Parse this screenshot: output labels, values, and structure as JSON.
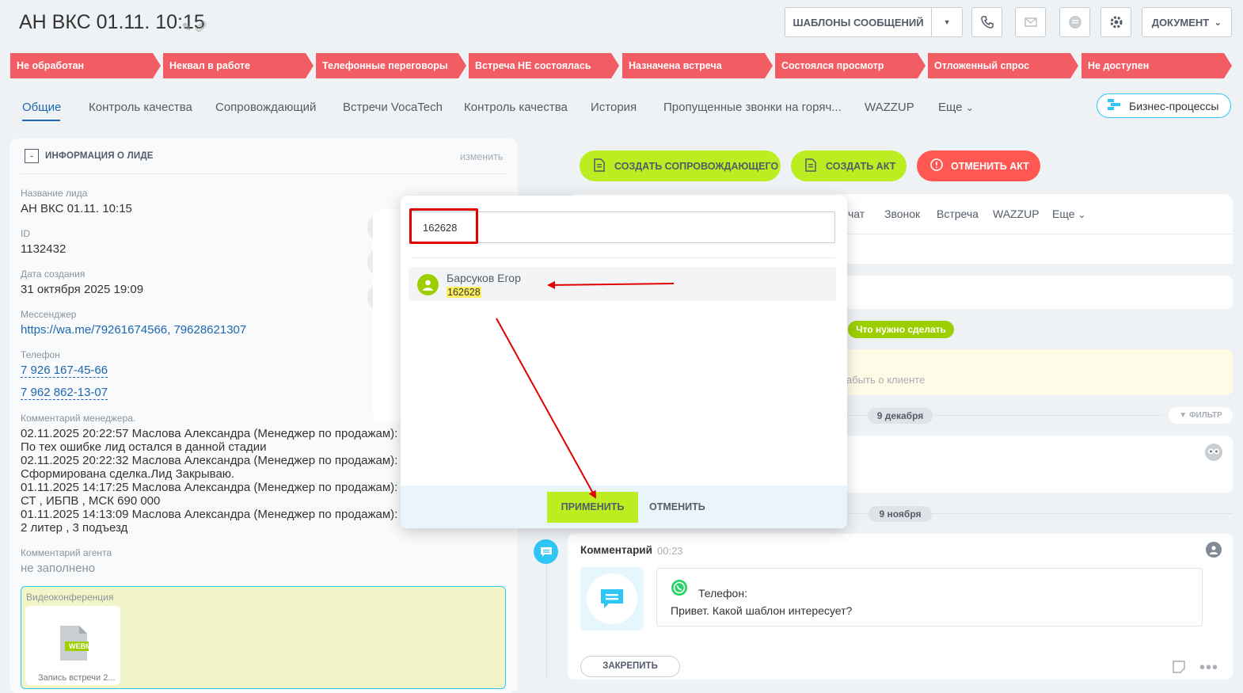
{
  "header": {
    "title": "АН ВКС 01.11. 10:15",
    "templates_button": "ШАБЛОНЫ СООБЩЕНИЙ",
    "document_button": "ДОКУМЕНТ"
  },
  "stages": [
    "Не обработан",
    "Неквал в работе",
    "Телефонные переговоры",
    "Встреча НЕ состоялась",
    "Назначена встреча",
    "Состоялся просмотр",
    "Отложенный спрос",
    "Не доступен"
  ],
  "colors": {
    "stage": "#f25c63",
    "accent_blue": "#2067b0",
    "green_button": "#bbed21",
    "red_button": "#ff5752",
    "highlight": "#ffef5a",
    "annotation_red": "#e10000"
  },
  "tabs": [
    "Общие",
    "Контроль качества",
    "Сопровождающий",
    "Встречи VocaTech",
    "Контроль качества",
    "История",
    "Пропущенные звонки на горяч...",
    "WAZZUP",
    "Еще"
  ],
  "business_processes": "Бизнес-процессы",
  "lead_info": {
    "collapse_symbol": "-",
    "section_title": "ИНФОРМАЦИЯ О ЛИДЕ",
    "edit_link": "изменить",
    "name_label": "Название лида",
    "name_value": "АН ВКС 01.11. 10:15",
    "id_label": "ID",
    "id_value": "1132432",
    "created_label": "Дата создания",
    "created_value": "31 октября 2025 19:09",
    "messenger_label": "Мессенджер",
    "messenger_value": "https://wa.me/79261674566, 79628621307",
    "phone_label": "Телефон",
    "phone_1": "7 926 167-45-66",
    "phone_2": "7 962 862-13-07",
    "manager_comment_label": "Комментарий менеджера.",
    "manager_comment_lines": [
      "02.11.2025 20:22:57 Маслова Александра (Менеджер по продажам):",
      "По тех ошибке лид остался в данной стадии",
      "02.11.2025 20:22:32 Маслова Александра (Менеджер по продажам):",
      "Сформирована сделка.Лид Закрываю.",
      "01.11.2025 14:17:25 Маслова Александра (Менеджер по продажам):",
      "СТ , ИБПВ , МСК 690 000",
      "01.11.2025 14:13:09 Маслова Александра (Менеджер по продажам):",
      "2 литер , 3 подъезд"
    ],
    "agent_comment_label": "Комментарий агента",
    "agent_comment_value": "не заполнено",
    "video_label": "Видеоконференция",
    "video_file_badge": "WEBM",
    "video_file_name": "Запись встречи 2..."
  },
  "actions": {
    "create_companion": "СОЗДАТЬ СОПРОВОЖДАЮЩЕГО",
    "create_act": "СОЗДАТЬ АКТ",
    "cancel_act": "ОТМЕНИТЬ АКТ"
  },
  "activity_tabs": [
    "чат",
    "Звонок",
    "Встреча",
    "WAZZUP",
    "Еще"
  ],
  "timeline": {
    "todo_badge": "Что нужно сделать",
    "todo_placeholder": "абыть о клиенте",
    "date_1": "9 декабря",
    "filter": "ФИЛЬТР",
    "date_2": "9 ноября",
    "comment_title": "Комментарий",
    "comment_time": "00:23",
    "message_phone_label": "Телефон:",
    "message_text": "Привет. Какой шаблон интересует?",
    "pin_button": "ЗАКРЕПИТЬ",
    "more": "•••"
  },
  "popup": {
    "search_value": "162628",
    "result_name": "Барсуков Егор",
    "result_id": "162628",
    "apply": "ПРИМЕНИТЬ",
    "cancel": "ОТМЕНИТЬ"
  }
}
